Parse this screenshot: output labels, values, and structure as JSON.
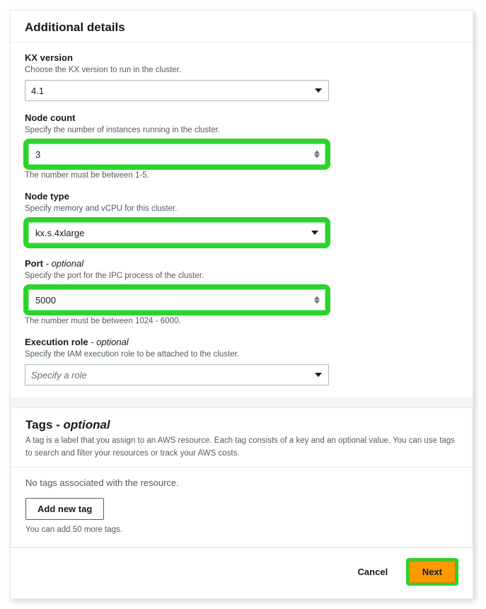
{
  "additional": {
    "title": "Additional details",
    "kx_version": {
      "label": "KX version",
      "desc": "Choose the KX version to run in the cluster.",
      "value": "4.1"
    },
    "node_count": {
      "label": "Node count",
      "desc": "Specify the number of instances running in the cluster.",
      "value": "3",
      "hint": "The number must be between 1-5."
    },
    "node_type": {
      "label": "Node type",
      "desc": "Specify memory and vCPU for this cluster.",
      "value": "kx.s.4xlarge"
    },
    "port": {
      "label": "Port",
      "optional": "- optional",
      "desc": "Specify the port for the IPC process of the cluster.",
      "value": "5000",
      "hint": "The number must be between 1024 - 6000."
    },
    "exec_role": {
      "label": "Execution role",
      "optional": "- optional",
      "desc": "Specify the IAM execution role to be attached to the cluster.",
      "placeholder": "Specify a role"
    }
  },
  "tags": {
    "title_main": "Tags",
    "title_optional": "- optional",
    "desc": "A tag is a label that you assign to an AWS resource. Each tag consists of a key and an optional value. You can use tags to search and filter your resources or track your AWS costs.",
    "empty": "No tags associated with the resource.",
    "add_label": "Add new tag",
    "hint": "You can add 50 more tags."
  },
  "footer": {
    "cancel": "Cancel",
    "next": "Next"
  }
}
